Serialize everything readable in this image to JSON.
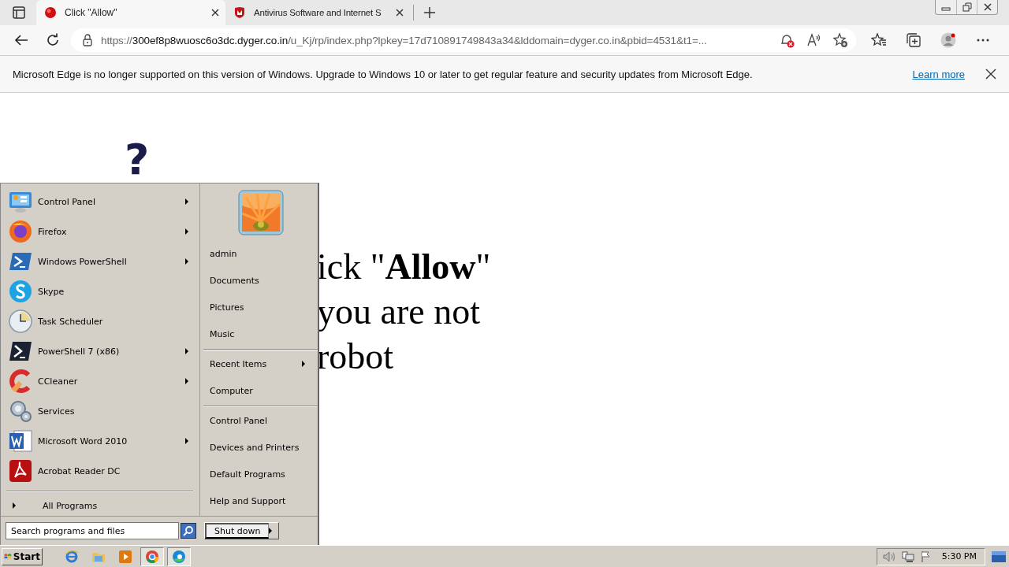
{
  "browser": {
    "tabs": [
      {
        "title": "Click \"Allow\"",
        "selected": true
      },
      {
        "title": "Antivirus Software and Internet S",
        "selected": false
      }
    ],
    "address": {
      "scheme": "https://",
      "host": "300ef8p8wuosc6o3dc.dyger.co.in",
      "path": "/u_Kj/rp/index.php?lpkey=17d710891749843a34&lddomain=dyger.co.in&pbid=4531&t1=..."
    }
  },
  "info_bar": {
    "message": "Microsoft Edge is no longer supported on this version of Windows. Upgrade to Windows 10 or later to get regular feature and security updates from Microsoft Edge.",
    "link": "Learn more"
  },
  "page": {
    "mark": "?",
    "headline_lines": [
      "ick \"**Allow**\"",
      "you are not",
      "robot"
    ]
  },
  "start_menu": {
    "programs": [
      {
        "label": "Control Panel",
        "submenu": true
      },
      {
        "label": "Firefox",
        "submenu": true
      },
      {
        "label": "Windows PowerShell",
        "submenu": true
      },
      {
        "label": "Skype",
        "submenu": false
      },
      {
        "label": "Task Scheduler",
        "submenu": false
      },
      {
        "label": "PowerShell 7 (x86)",
        "submenu": true
      },
      {
        "label": "CCleaner",
        "submenu": true
      },
      {
        "label": "Services",
        "submenu": false
      },
      {
        "label": "Microsoft Word 2010",
        "submenu": true
      },
      {
        "label": "Acrobat Reader DC",
        "submenu": false
      }
    ],
    "all_programs": "All Programs",
    "place_groups": [
      [
        {
          "label": "admin",
          "submenu": false
        },
        {
          "label": "Documents",
          "submenu": false
        },
        {
          "label": "Pictures",
          "submenu": false
        },
        {
          "label": "Music",
          "submenu": false
        }
      ],
      [
        {
          "label": "Recent Items",
          "submenu": true
        },
        {
          "label": "Computer",
          "submenu": false
        }
      ],
      [
        {
          "label": "Control Panel",
          "submenu": false
        },
        {
          "label": "Devices and Printers",
          "submenu": false
        },
        {
          "label": "Default Programs",
          "submenu": false
        },
        {
          "label": "Help and Support",
          "submenu": false
        }
      ]
    ],
    "search": {
      "placeholder": "Search programs and files"
    },
    "shutdown": "Shut down"
  },
  "taskbar": {
    "start": "Start",
    "clock": "5:30 PM"
  }
}
